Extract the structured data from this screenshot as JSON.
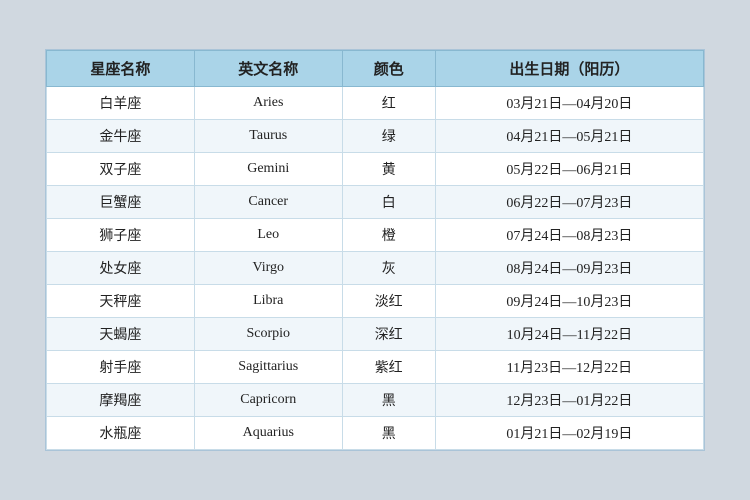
{
  "table": {
    "headers": [
      "星座名称",
      "英文名称",
      "颜色",
      "出生日期（阳历）"
    ],
    "rows": [
      {
        "chinese": "白羊座",
        "english": "Aries",
        "color": "红",
        "dates": "03月21日—04月20日"
      },
      {
        "chinese": "金牛座",
        "english": "Taurus",
        "color": "绿",
        "dates": "04月21日—05月21日"
      },
      {
        "chinese": "双子座",
        "english": "Gemini",
        "color": "黄",
        "dates": "05月22日—06月21日"
      },
      {
        "chinese": "巨蟹座",
        "english": "Cancer",
        "color": "白",
        "dates": "06月22日—07月23日"
      },
      {
        "chinese": "狮子座",
        "english": "Leo",
        "color": "橙",
        "dates": "07月24日—08月23日"
      },
      {
        "chinese": "处女座",
        "english": "Virgo",
        "color": "灰",
        "dates": "08月24日—09月23日"
      },
      {
        "chinese": "天秤座",
        "english": "Libra",
        "color": "淡红",
        "dates": "09月24日—10月23日"
      },
      {
        "chinese": "天蝎座",
        "english": "Scorpio",
        "color": "深红",
        "dates": "10月24日—11月22日"
      },
      {
        "chinese": "射手座",
        "english": "Sagittarius",
        "color": "紫红",
        "dates": "11月23日—12月22日"
      },
      {
        "chinese": "摩羯座",
        "english": "Capricorn",
        "color": "黑",
        "dates": "12月23日—01月22日"
      },
      {
        "chinese": "水瓶座",
        "english": "Aquarius",
        "color": "黑",
        "dates": "01月21日—02月19日"
      }
    ]
  }
}
